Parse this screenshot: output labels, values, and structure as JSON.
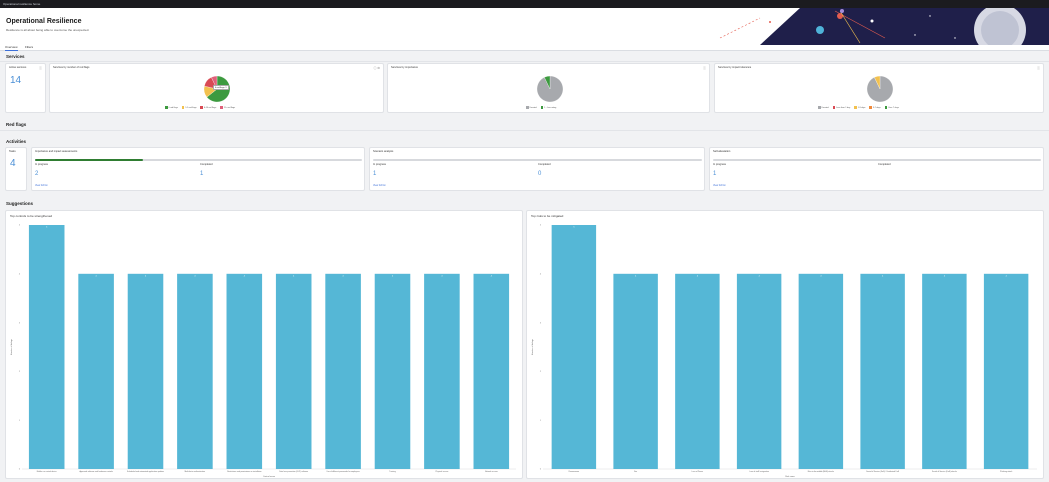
{
  "window": {
    "title": "Operational resilience home"
  },
  "header": {
    "title": "Operational Resilience",
    "subtitle": "Resilience is all about being able to overcome the unexpected."
  },
  "tabs": [
    {
      "label": "Overview"
    },
    {
      "label": "Filters"
    }
  ],
  "sections": {
    "services": "Services",
    "red_flags": "Red flags",
    "activities": "Activities",
    "suggestions": "Suggestions"
  },
  "services": {
    "active": {
      "title": "Active services",
      "value": "14"
    },
    "red_flags": {
      "title": "Services by number of red flags",
      "tooltip": "0 red flags: 9",
      "legend": [
        "0 red flags",
        "1-5 red flags",
        "6-10 red flags",
        "11+ red flags"
      ]
    },
    "importance": {
      "title": "Services by importance",
      "legend": [
        "Unrated",
        "1 - Low rating"
      ]
    },
    "tolerance": {
      "title": "Services by impact tolerance",
      "legend": [
        "Unrated",
        "Less than 1 day",
        "1-3 days",
        "3-7 days",
        "Over 7 days"
      ]
    }
  },
  "activities": {
    "tasks": {
      "title": "Tasks",
      "value": "4"
    },
    "cards": [
      {
        "title": "Importance and impact assessments",
        "in_progress_label": "In progress",
        "completed_label": "Completed",
        "in_progress": "2",
        "completed": "1",
        "link": "View full list",
        "progress": 0.33
      },
      {
        "title": "Scenario analysis",
        "in_progress_label": "In progress",
        "completed_label": "Completed",
        "in_progress": "1",
        "completed": "0",
        "link": "View full list",
        "progress": 0.0
      },
      {
        "title": "Self-attestation",
        "in_progress_label": "In progress",
        "completed_label": "Completed",
        "in_progress": "1",
        "completed": "",
        "link": "View full list",
        "progress": 0.0
      }
    ]
  },
  "colors": {
    "bar": "#55b7d6",
    "pie_grey": "#a7a9ad",
    "green": "#3c9a3f",
    "yellow": "#f2c14e",
    "orange": "#f08a3c",
    "red": "#d94a54",
    "pink": "#e0607a",
    "accent": "#4a8fd6"
  },
  "chart_data": [
    {
      "type": "pie",
      "title": "Services by number of red flags",
      "categories": [
        "0 red flags",
        "1-5 red flags",
        "6-10 red flags",
        "11+ red flags"
      ],
      "values": [
        9,
        2,
        2,
        1
      ]
    },
    {
      "type": "pie",
      "title": "Services by importance",
      "categories": [
        "Unrated",
        "1 - Low rating"
      ],
      "values": [
        13,
        1
      ]
    },
    {
      "type": "pie",
      "title": "Services by impact tolerance",
      "categories": [
        "Unrated",
        "Less than 1 day",
        "1-3 days",
        "3-7 days",
        "Over 7 days"
      ],
      "values": [
        13,
        0,
        1,
        0,
        0
      ]
    },
    {
      "type": "bar",
      "title": "Top controls to be strengthened",
      "xlabel": "Control name",
      "ylabel": "Number of failings",
      "categories": [
        "Mobile car control device",
        "Approved software and hardware controls",
        "Scheduled and automated application updates",
        "Multi-factor authentication",
        "Restrictions and permissions on installation",
        "Data loss prevention (DLP) software",
        "Use of different passwords for employees",
        "Training",
        "Physical access",
        "Network access"
      ],
      "values": [
        5,
        4,
        4,
        4,
        4,
        4,
        4,
        4,
        4,
        4
      ],
      "ylim": [
        0,
        5
      ]
    },
    {
      "type": "bar",
      "title": "Top risks to be mitigated",
      "xlabel": "Risk name",
      "ylabel": "Number of failings",
      "categories": [
        "Ransomware",
        "Fire",
        "Loss of Power",
        "Loss of staff/ resignation",
        "Man-in-the-middle (MitM) attacks",
        "Denial of Service (DoS) / Distributed DoS",
        "Denial of Service (DoS) attacks",
        "Phishing attack"
      ],
      "values": [
        5,
        4,
        4,
        4,
        4,
        4,
        4,
        4
      ],
      "ylim": [
        0,
        5
      ]
    }
  ]
}
